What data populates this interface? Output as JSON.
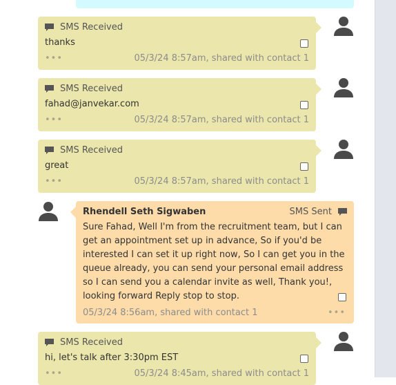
{
  "conversation": {
    "top_partial": {
      "text": "...."
    },
    "messages": [
      {
        "direction": "received",
        "type_label": "SMS Received",
        "body": "thanks",
        "meta": "05/3/24 8:57am, shared with contact 1",
        "more": "•••"
      },
      {
        "direction": "received",
        "type_label": "SMS Received",
        "body": "fahad@janvekar.com",
        "meta": "05/3/24 8:57am, shared with contact 1",
        "more": "•••"
      },
      {
        "direction": "received",
        "type_label": "SMS Received",
        "body": "great",
        "meta": "05/3/24 8:57am, shared with contact 1",
        "more": "•••"
      },
      {
        "direction": "sent",
        "sender": "Rhendell Seth Sigwaben",
        "type_label": "SMS Sent",
        "body_lines": [
          "Sure Fahad, Well I'm from the recruitment team, but I can",
          "get an appointment set up in advance, So if you'd be",
          "interested I can set it up right now, So I can get you in the",
          "queue already, you can send your personal email address",
          "so I can send you a calendar invite as well, Thank you!,",
          "looking forward Reply stop to stop."
        ],
        "meta": "05/3/24 8:56am, shared with contact 1",
        "more": "•••"
      },
      {
        "direction": "received",
        "type_label": "SMS Received",
        "body": "hi, let's talk after 3:30pm EST",
        "meta": "05/3/24 8:45am, shared with contact 1",
        "more": "•••"
      }
    ]
  },
  "colors": {
    "received_bg": "#ebe6ab",
    "sent_bg": "#fddcaa",
    "top_bg": "#d3fbff",
    "sidebar_bg": "#e4e6ee"
  }
}
